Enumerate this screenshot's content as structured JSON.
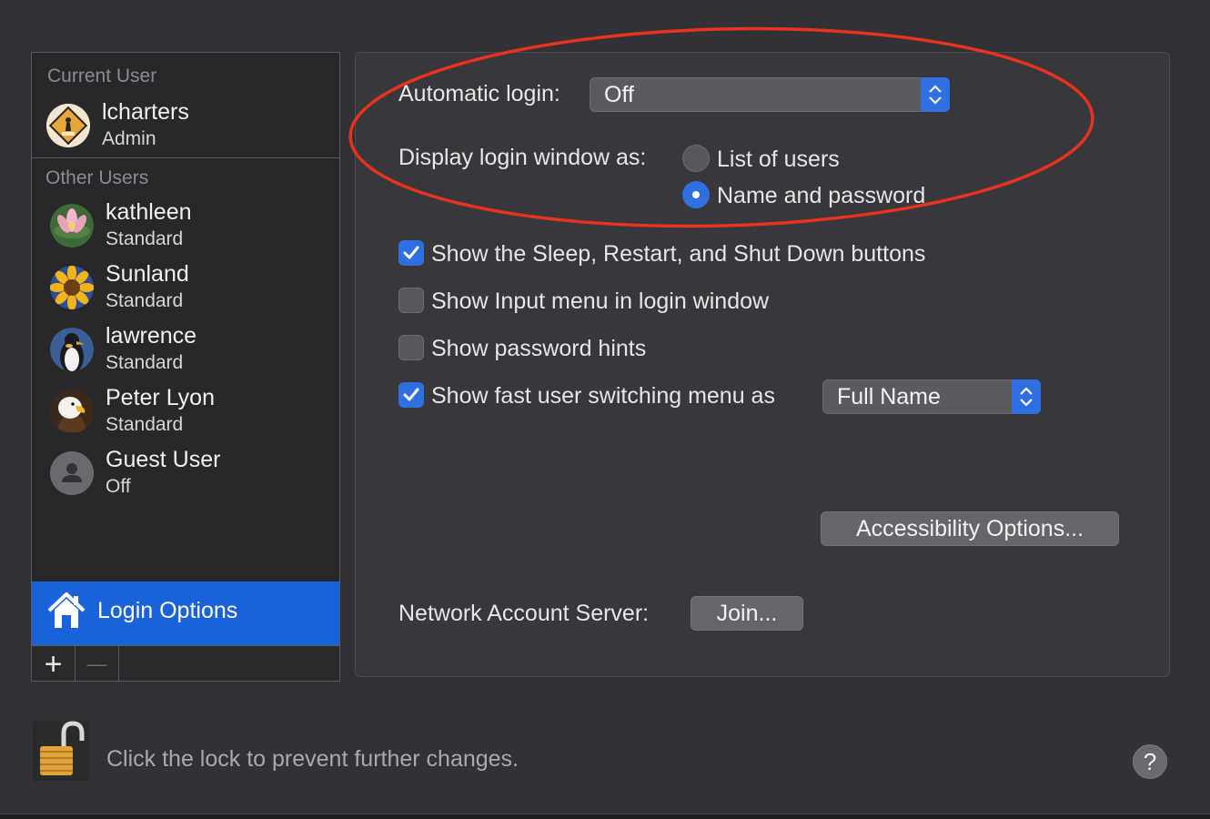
{
  "sidebar": {
    "current_user_label": "Current User",
    "other_users_label": "Other Users",
    "current_user": {
      "name": "lcharters",
      "role": "Admin"
    },
    "other_users": [
      {
        "name": "kathleen",
        "role": "Standard"
      },
      {
        "name": "Sunland",
        "role": "Standard"
      },
      {
        "name": "lawrence",
        "role": "Standard"
      },
      {
        "name": "Peter Lyon",
        "role": "Standard"
      },
      {
        "name": "Guest User",
        "role": "Off"
      }
    ],
    "login_options_label": "Login Options",
    "add_symbol": "+",
    "remove_symbol": "—"
  },
  "login": {
    "automatic_login_label": "Automatic login:",
    "automatic_login_value": "Off",
    "display_window_label": "Display login window as:",
    "radio_list_users": "List of users",
    "radio_name_password": "Name and password",
    "selected_display": "Name and password",
    "checks": [
      {
        "label": "Show the Sleep, Restart, and Shut Down buttons",
        "checked": true
      },
      {
        "label": "Show Input menu in login window",
        "checked": false
      },
      {
        "label": "Show password hints",
        "checked": false
      },
      {
        "label": "Show fast user switching menu as",
        "checked": true
      }
    ],
    "fast_switch_value": "Full Name",
    "accessibility_button": "Accessibility Options...",
    "network_server_label": "Network Account Server:",
    "join_button": "Join..."
  },
  "footer": {
    "lock_text": "Click the lock to prevent further changes.",
    "help_symbol": "?"
  },
  "colors": {
    "accent": "#1a62d9",
    "annotation": "#e8321f",
    "background": "#323236"
  },
  "icons": {
    "lock": "unlocked-padlock-icon",
    "login_options": "house-icon",
    "help": "question-mark-icon"
  }
}
